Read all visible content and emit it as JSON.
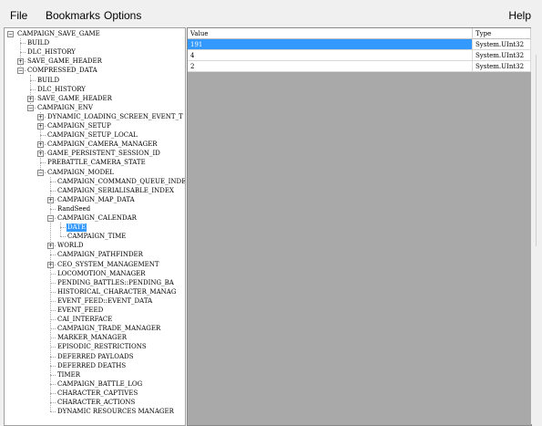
{
  "menu": {
    "file": "File",
    "bookmarks": "Bookmarks",
    "options": "Options",
    "help": "Help"
  },
  "tree": [
    {
      "label": "CAMPAIGN_SAVE_GAME",
      "depth": 0,
      "toggle": "−",
      "selected": false
    },
    {
      "label": "BUILD",
      "depth": 1,
      "toggle": "",
      "selected": false
    },
    {
      "label": "DLC_HISTORY",
      "depth": 1,
      "toggle": "",
      "selected": false
    },
    {
      "label": "SAVE_GAME_HEADER",
      "depth": 1,
      "toggle": "+",
      "selected": false
    },
    {
      "label": "COMPRESSED_DATA",
      "depth": 1,
      "toggle": "−",
      "selected": false
    },
    {
      "label": "BUILD",
      "depth": 2,
      "toggle": "",
      "selected": false
    },
    {
      "label": "DLC_HISTORY",
      "depth": 2,
      "toggle": "",
      "selected": false
    },
    {
      "label": "SAVE_GAME_HEADER",
      "depth": 2,
      "toggle": "+",
      "selected": false
    },
    {
      "label": "CAMPAIGN_ENV",
      "depth": 2,
      "toggle": "−",
      "selected": false
    },
    {
      "label": "DYNAMIC_LOADING_SCREEN_EVENT_T",
      "depth": 3,
      "toggle": "+",
      "selected": false
    },
    {
      "label": "CAMPAIGN_SETUP",
      "depth": 3,
      "toggle": "+",
      "selected": false
    },
    {
      "label": "CAMPAIGN_SETUP_LOCAL",
      "depth": 3,
      "toggle": "",
      "selected": false
    },
    {
      "label": "CAMPAIGN_CAMERA_MANAGER",
      "depth": 3,
      "toggle": "+",
      "selected": false
    },
    {
      "label": "GAME_PERSISTENT_SESSION_ID",
      "depth": 3,
      "toggle": "+",
      "selected": false
    },
    {
      "label": "PREBATTLE_CAMERA_STATE",
      "depth": 3,
      "toggle": "",
      "selected": false
    },
    {
      "label": "CAMPAIGN_MODEL",
      "depth": 3,
      "toggle": "−",
      "selected": false
    },
    {
      "label": "CAMPAIGN_COMMAND_QUEUE_INDE",
      "depth": 4,
      "toggle": "",
      "selected": false
    },
    {
      "label": "CAMPAIGN_SERIALISABLE_INDEX",
      "depth": 4,
      "toggle": "",
      "selected": false
    },
    {
      "label": "CAMPAIGN_MAP_DATA",
      "depth": 4,
      "toggle": "+",
      "selected": false
    },
    {
      "label": "RandSeed",
      "depth": 4,
      "toggle": "",
      "selected": false
    },
    {
      "label": "CAMPAIGN_CALENDAR",
      "depth": 4,
      "toggle": "−",
      "selected": false
    },
    {
      "label": "DATE",
      "depth": 5,
      "toggle": "",
      "selected": true
    },
    {
      "label": "CAMPAIGN_TIME",
      "depth": 5,
      "toggle": "",
      "selected": false
    },
    {
      "label": "WORLD",
      "depth": 4,
      "toggle": "+",
      "selected": false
    },
    {
      "label": "CAMPAIGN_PATHFINDER",
      "depth": 4,
      "toggle": "",
      "selected": false
    },
    {
      "label": "CEO_SYSTEM_MANAGEMENT",
      "depth": 4,
      "toggle": "+",
      "selected": false
    },
    {
      "label": "LOCOMOTION_MANAGER",
      "depth": 4,
      "toggle": "",
      "selected": false
    },
    {
      "label": "PENDING_BATTLES::PENDING_BA",
      "depth": 4,
      "toggle": "",
      "selected": false
    },
    {
      "label": "HISTORICAL_CHARACTER_MANAG",
      "depth": 4,
      "toggle": "",
      "selected": false
    },
    {
      "label": "EVENT_FEED::EVENT_DATA",
      "depth": 4,
      "toggle": "",
      "selected": false
    },
    {
      "label": "EVENT_FEED",
      "depth": 4,
      "toggle": "",
      "selected": false
    },
    {
      "label": "CAI_INTERFACE",
      "depth": 4,
      "toggle": "",
      "selected": false
    },
    {
      "label": "CAMPAIGN_TRADE_MANAGER",
      "depth": 4,
      "toggle": "",
      "selected": false
    },
    {
      "label": "MARKER_MANAGER",
      "depth": 4,
      "toggle": "",
      "selected": false
    },
    {
      "label": "EPISODIC_RESTRICTIONS",
      "depth": 4,
      "toggle": "",
      "selected": false
    },
    {
      "label": "DEFERRED PAYLOADS",
      "depth": 4,
      "toggle": "",
      "selected": false
    },
    {
      "label": "DEFERRED DEATHS",
      "depth": 4,
      "toggle": "",
      "selected": false
    },
    {
      "label": "TIMER",
      "depth": 4,
      "toggle": "",
      "selected": false
    },
    {
      "label": "CAMPAIGN_BATTLE_LOG",
      "depth": 4,
      "toggle": "",
      "selected": false
    },
    {
      "label": "CHARACTER_CAPTIVES",
      "depth": 4,
      "toggle": "",
      "selected": false
    },
    {
      "label": "CHARACTER_ACTIONS",
      "depth": 4,
      "toggle": "",
      "selected": false
    },
    {
      "label": "DYNAMIC RESOURCES MANAGER",
      "depth": 4,
      "toggle": "",
      "selected": false
    }
  ],
  "grid": {
    "columns": [
      "Value",
      "Type"
    ],
    "rows": [
      {
        "value": "191",
        "type": "System.UInt32",
        "selected": true
      },
      {
        "value": "4",
        "type": "System.UInt32",
        "selected": false
      },
      {
        "value": "2",
        "type": "System.UInt32",
        "selected": false
      }
    ]
  },
  "colors": {
    "selection": "#3399ff",
    "empty_area": "#a9a9a9",
    "menubar": "#f0f0f0"
  },
  "icons": {
    "expanded": "minus-box-icon",
    "collapsed": "plus-box-icon"
  }
}
